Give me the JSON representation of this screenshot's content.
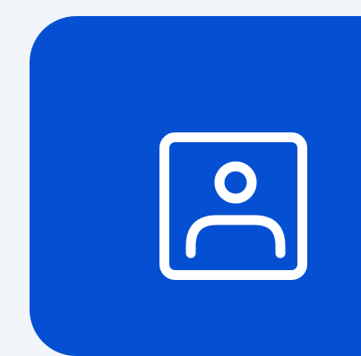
{
  "tile": {
    "icon": "user-profile-icon",
    "background_color": "#0550d2",
    "icon_color": "#ffffff",
    "page_background": "#f1f4f8"
  }
}
